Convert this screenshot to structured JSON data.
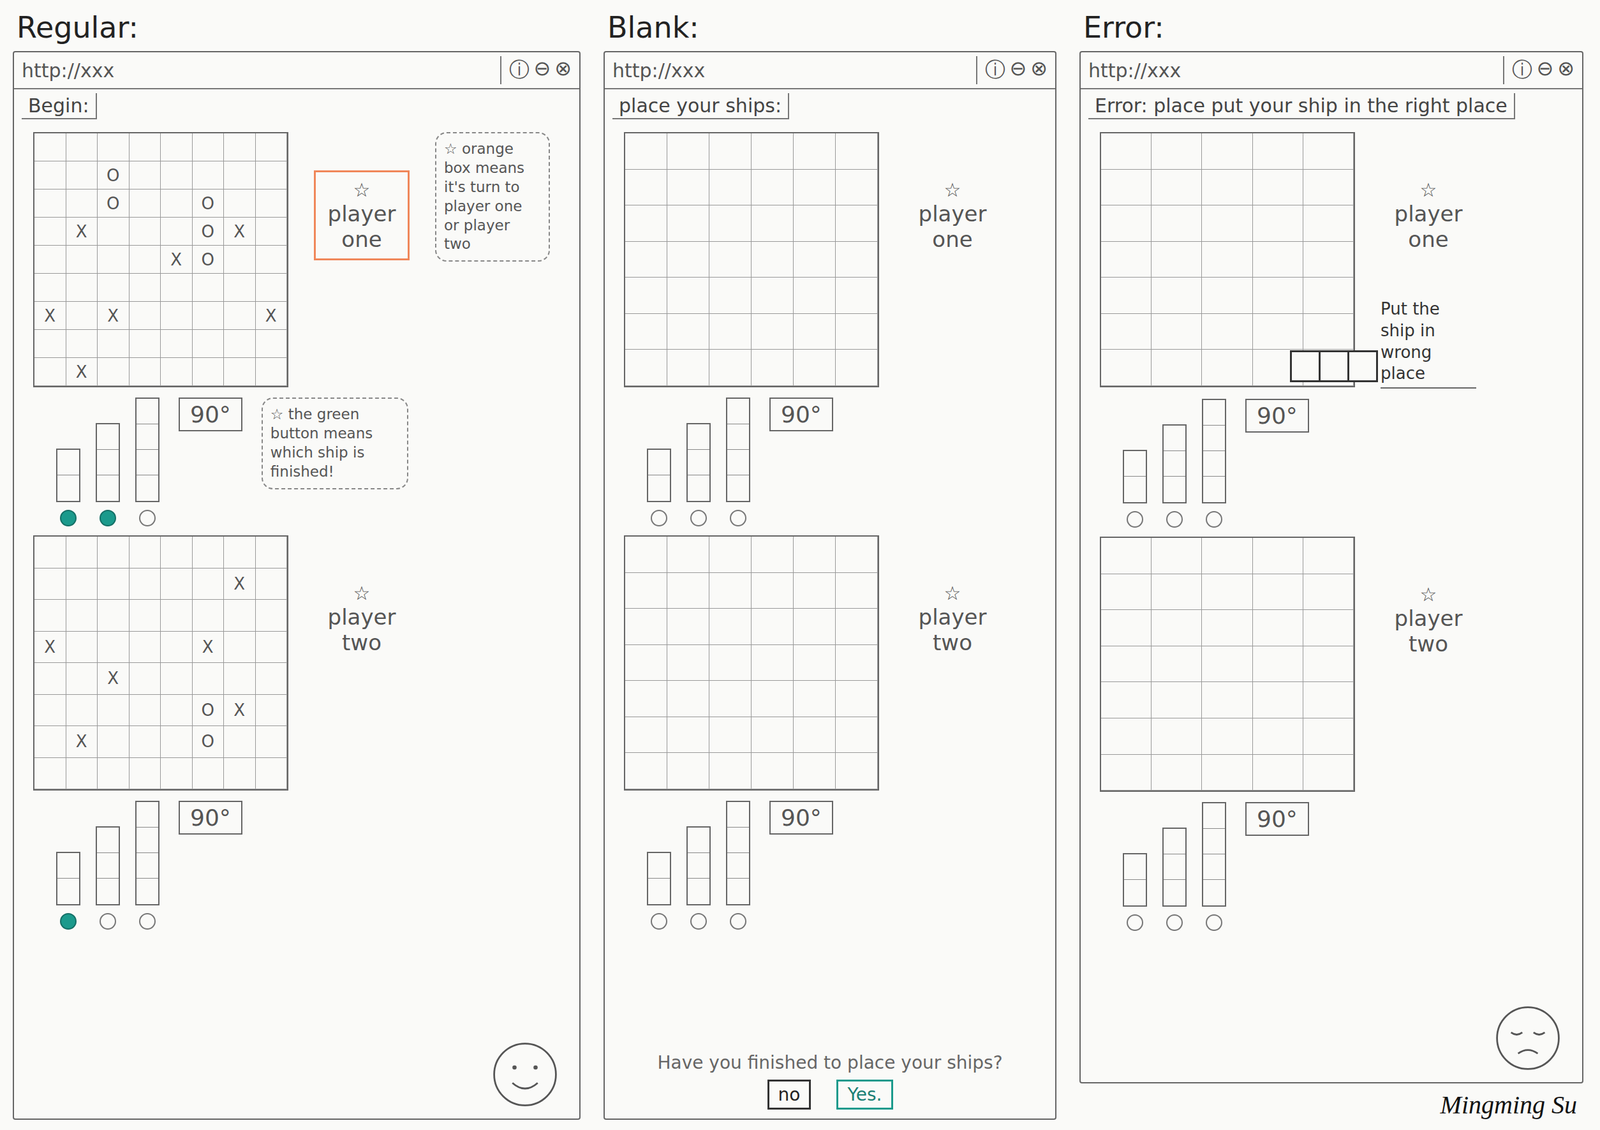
{
  "signature": "Mingming Su",
  "columns": [
    {
      "title": "Regular:",
      "url": "http://xxx",
      "window_buttons": [
        "ⓘ",
        "⊖",
        "⊗"
      ],
      "header": "Begin:",
      "face": "happy",
      "boards": [
        {
          "star": "☆",
          "player": "player one",
          "active": true,
          "rotate": "90°",
          "turn_note": "☆ orange box means it's turn to player one or player two",
          "ships_note": "☆ the green button means which ship is finished!",
          "ships": [
            {
              "cells": 2,
              "finished": true
            },
            {
              "cells": 3,
              "finished": true
            },
            {
              "cells": 4,
              "finished": false
            }
          ],
          "cells": [
            [
              "",
              "",
              "",
              "",
              "",
              "",
              "",
              ""
            ],
            [
              "",
              "",
              "O",
              "",
              "",
              "",
              "",
              ""
            ],
            [
              "",
              "",
              "O",
              "",
              "",
              "O",
              "",
              ""
            ],
            [
              "",
              "X",
              "",
              "",
              "",
              "O",
              "X",
              ""
            ],
            [
              "",
              "",
              "",
              "",
              "X",
              "O",
              "",
              ""
            ],
            [
              "",
              "",
              "",
              "",
              "",
              "",
              "",
              ""
            ],
            [
              "X",
              "",
              "X",
              "",
              "",
              "",
              "",
              "X"
            ],
            [
              "",
              "",
              "",
              "",
              "",
              "",
              "",
              ""
            ],
            [
              "",
              "X",
              "",
              "",
              "",
              "",
              "",
              ""
            ]
          ]
        },
        {
          "star": "☆",
          "player": "player two",
          "active": false,
          "rotate": "90°",
          "ships": [
            {
              "cells": 2,
              "finished": true
            },
            {
              "cells": 3,
              "finished": false
            },
            {
              "cells": 4,
              "finished": false
            }
          ],
          "cells": [
            [
              "",
              "",
              "",
              "",
              "",
              "",
              "",
              ""
            ],
            [
              "",
              "",
              "",
              "",
              "",
              "",
              "X",
              ""
            ],
            [
              "",
              "",
              "",
              "",
              "",
              "",
              "",
              ""
            ],
            [
              "X",
              "",
              "",
              "",
              "",
              "X",
              "",
              ""
            ],
            [
              "",
              "",
              "X",
              "",
              "",
              "",
              "",
              ""
            ],
            [
              "",
              "",
              "",
              "",
              "",
              "O",
              "X",
              ""
            ],
            [
              "",
              "X",
              "",
              "",
              "",
              "O",
              "",
              ""
            ],
            [
              "",
              "",
              "",
              "",
              "",
              "",
              "",
              ""
            ]
          ]
        }
      ]
    },
    {
      "title": "Blank:",
      "url": "http://xxx",
      "window_buttons": [
        "ⓘ",
        "⊖",
        "⊗"
      ],
      "header": "place your ships:",
      "prompt": {
        "question": "Have you finished to place your ships?",
        "buttons": [
          {
            "label": "no",
            "selected": false
          },
          {
            "label": "Yes.",
            "selected": true
          }
        ]
      },
      "boards": [
        {
          "star": "☆",
          "player": "player one",
          "active": false,
          "rotate": "90°",
          "ships": [
            {
              "cells": 2,
              "finished": false
            },
            {
              "cells": 3,
              "finished": false
            },
            {
              "cells": 4,
              "finished": false
            }
          ],
          "cells": [
            [
              "",
              "",
              "",
              "",
              "",
              ""
            ],
            [
              "",
              "",
              "",
              "",
              "",
              ""
            ],
            [
              "",
              "",
              "",
              "",
              "",
              ""
            ],
            [
              "",
              "",
              "",
              "",
              "",
              ""
            ],
            [
              "",
              "",
              "",
              "",
              "",
              ""
            ],
            [
              "",
              "",
              "",
              "",
              "",
              ""
            ],
            [
              "",
              "",
              "",
              "",
              "",
              ""
            ]
          ]
        },
        {
          "star": "☆",
          "player": "player two",
          "active": false,
          "rotate": "90°",
          "ships": [
            {
              "cells": 2,
              "finished": false
            },
            {
              "cells": 3,
              "finished": false
            },
            {
              "cells": 4,
              "finished": false
            }
          ],
          "cells": [
            [
              "",
              "",
              "",
              "",
              "",
              ""
            ],
            [
              "",
              "",
              "",
              "",
              "",
              ""
            ],
            [
              "",
              "",
              "",
              "",
              "",
              ""
            ],
            [
              "",
              "",
              "",
              "",
              "",
              ""
            ],
            [
              "",
              "",
              "",
              "",
              "",
              ""
            ],
            [
              "",
              "",
              "",
              "",
              "",
              ""
            ],
            [
              "",
              "",
              "",
              "",
              "",
              ""
            ]
          ]
        }
      ]
    },
    {
      "title": "Error:",
      "url": "http://xxx",
      "window_buttons": [
        "ⓘ",
        "⊖",
        "⊗"
      ],
      "header": "Error: place put your ship in the right place",
      "face": "sad",
      "boards": [
        {
          "star": "☆",
          "player": "player one",
          "active": false,
          "rotate": "90°",
          "misplaced_ship": 3,
          "error_note": "Put the ship in wrong place",
          "ships": [
            {
              "cells": 2,
              "finished": false
            },
            {
              "cells": 3,
              "finished": false
            },
            {
              "cells": 4,
              "finished": false
            }
          ],
          "cells": [
            [
              "",
              "",
              "",
              "",
              ""
            ],
            [
              "",
              "",
              "",
              "",
              ""
            ],
            [
              "",
              "",
              "",
              "",
              ""
            ],
            [
              "",
              "",
              "",
              "",
              ""
            ],
            [
              "",
              "",
              "",
              "",
              ""
            ],
            [
              "",
              "",
              "",
              "",
              ""
            ],
            [
              "",
              "",
              "",
              "",
              ""
            ]
          ]
        },
        {
          "star": "☆",
          "player": "player two",
          "active": false,
          "rotate": "90°",
          "ships": [
            {
              "cells": 2,
              "finished": false
            },
            {
              "cells": 3,
              "finished": false
            },
            {
              "cells": 4,
              "finished": false
            }
          ],
          "cells": [
            [
              "",
              "",
              "",
              "",
              ""
            ],
            [
              "",
              "",
              "",
              "",
              ""
            ],
            [
              "",
              "",
              "",
              "",
              ""
            ],
            [
              "",
              "",
              "",
              "",
              ""
            ],
            [
              "",
              "",
              "",
              "",
              ""
            ],
            [
              "",
              "",
              "",
              "",
              ""
            ],
            [
              "",
              "",
              "",
              "",
              ""
            ]
          ]
        }
      ]
    }
  ]
}
